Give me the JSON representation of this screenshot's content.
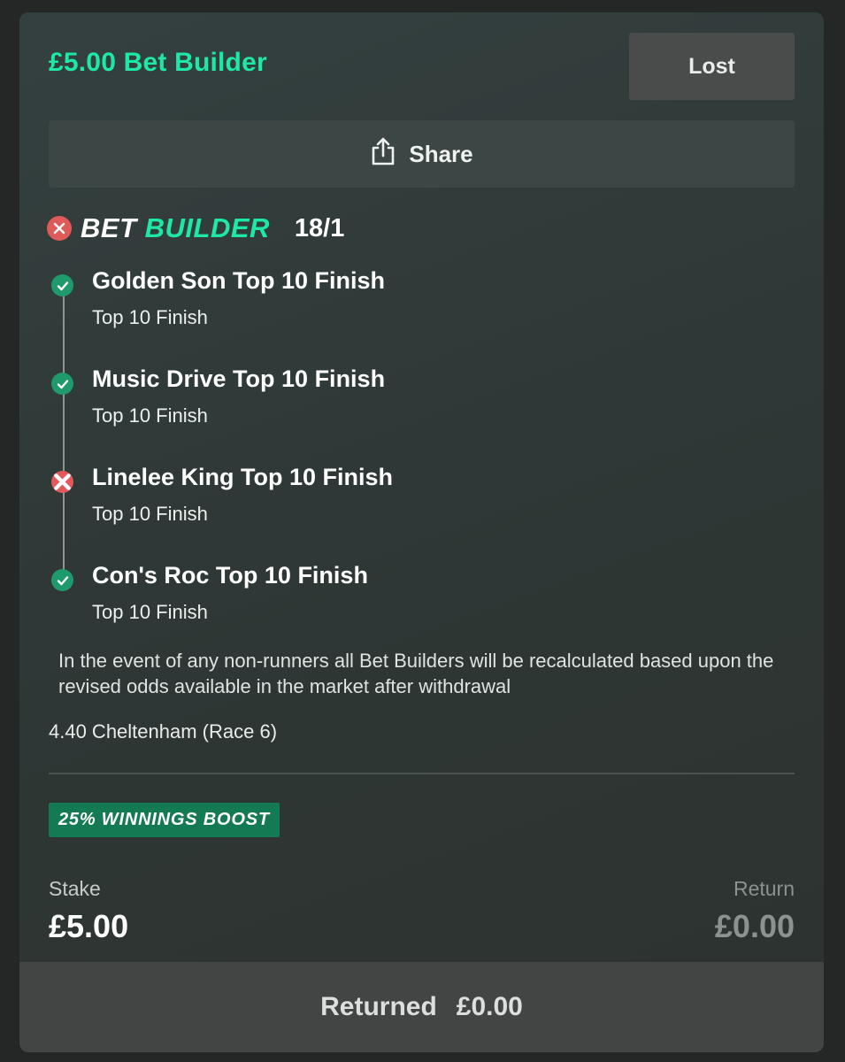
{
  "bet": {
    "title": "£5.00 Bet Builder",
    "status": "Lost",
    "share_label": "Share"
  },
  "builder": {
    "logo_part1": "BET",
    "logo_part2": "BUILDER",
    "odds": "18/1",
    "status_icon": "close-icon"
  },
  "legs": [
    {
      "name": "Golden Son Top 10 Finish",
      "market": "Top 10 Finish",
      "result": "won"
    },
    {
      "name": "Music Drive Top 10 Finish",
      "market": "Top 10 Finish",
      "result": "won"
    },
    {
      "name": "Linelee King Top 10 Finish",
      "market": "Top 10 Finish",
      "result": "lost"
    },
    {
      "name": "Con's Roc Top 10 Finish",
      "market": "Top 10 Finish",
      "result": "won"
    }
  ],
  "note": "In the event of any non-runners all Bet Builders will be recalculated based upon the revised odds available in the market after withdrawal",
  "event": "4.40 Cheltenham (Race 6)",
  "boost": "25% WINNINGS BOOST",
  "stake": {
    "label": "Stake",
    "value": "£5.00"
  },
  "return": {
    "label": "Return",
    "value": "£0.00"
  },
  "footer": {
    "label": "Returned",
    "value": "£0.00"
  },
  "colors": {
    "accent": "#1ee8a6",
    "won": "#1f9a6c",
    "lost": "#e05a5a",
    "boost_bg": "#137a53"
  }
}
